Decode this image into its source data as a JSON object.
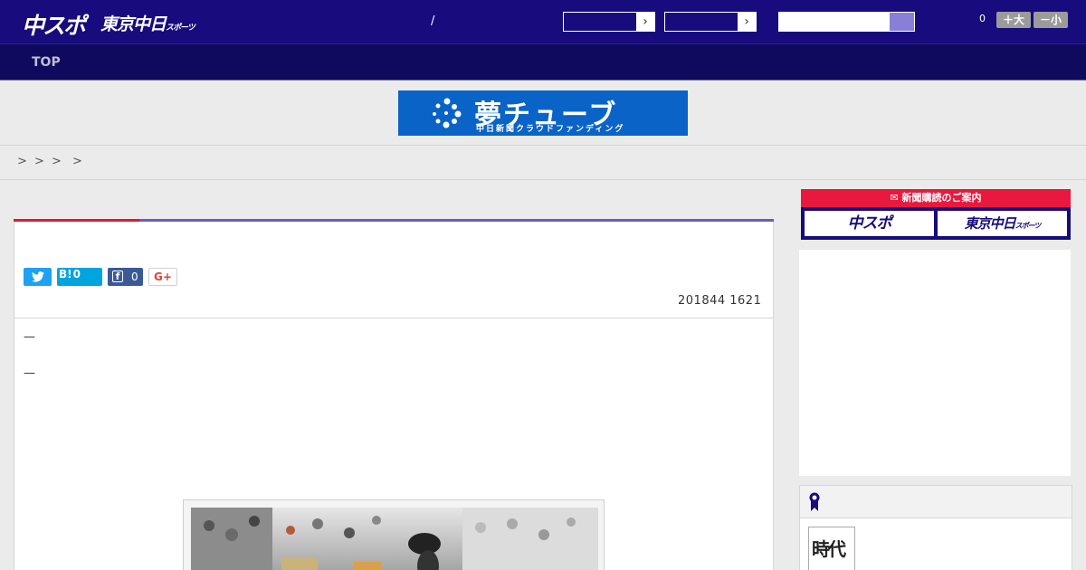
{
  "header": {
    "logo_chuspo": "中スポ",
    "logo_tokyo": "東京中日",
    "logo_tokyo_sub": "スポーツ",
    "separator": "/",
    "select1_value": "",
    "select2_value": "",
    "search_placeholder": "",
    "font_size_count": "0",
    "font_larger_label": "＋大",
    "font_smaller_label": "－小"
  },
  "nav": {
    "items": [
      {
        "label": "TOP"
      }
    ]
  },
  "banner": {
    "title": "夢チューブ",
    "subtitle": "中日新聞クラウドファンディング"
  },
  "breadcrumb": {
    "separators": [
      ">",
      ">",
      ">",
      ">"
    ]
  },
  "article": {
    "share": {
      "twitter_icon": "twitter-icon",
      "hatena_label": "B!",
      "hatena_count": "0",
      "facebook_icon_label": "f",
      "facebook_count": "0",
      "gplus_label": "G+"
    },
    "date": "201844 1621",
    "lines": [
      "—",
      "—"
    ]
  },
  "sidebar": {
    "paper_header": "新聞購読のご案内",
    "paper_chuspo": "中スポ",
    "paper_tokyo": "東京中日",
    "paper_tokyo_sub": "スポーツ",
    "thumb_text": "時代"
  },
  "colors": {
    "header_bg": "#170b7d",
    "nav_bg": "#100a5e",
    "accent_red": "#e31635",
    "accent_purple": "#6a5cbf",
    "banner_blue": "#0a64c8"
  }
}
